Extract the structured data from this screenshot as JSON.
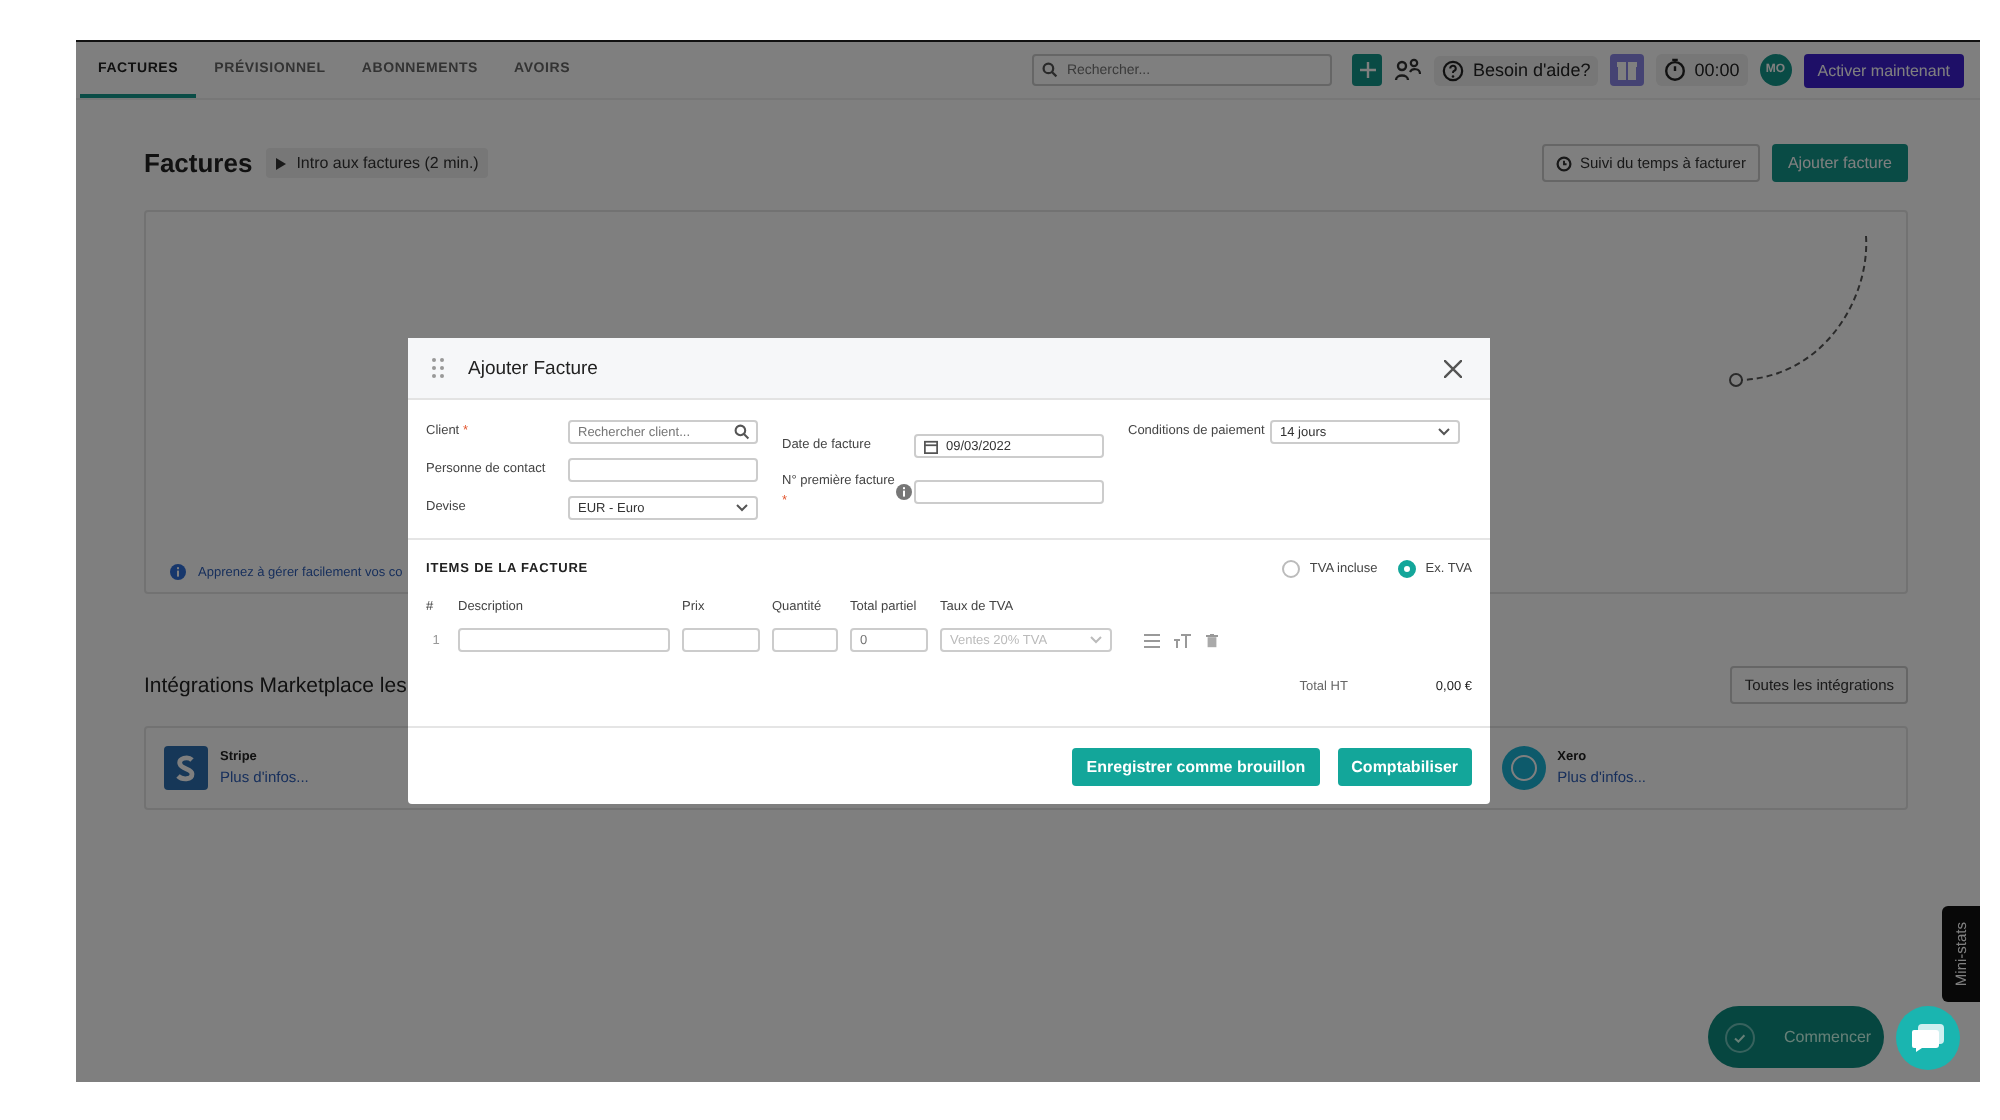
{
  "top_tabs": [
    {
      "label": "FACTURES",
      "selected": true
    },
    {
      "label": "PRÉVISIONNEL",
      "selected": false
    },
    {
      "label": "ABONNEMENTS",
      "selected": false
    },
    {
      "label": "AVOIRS",
      "selected": false
    }
  ],
  "search": {
    "placeholder": "Rechercher..."
  },
  "help": "Besoin d'aide?",
  "timer": "00:00",
  "avatar": "MO",
  "activate_button": "Activer maintenant",
  "page": {
    "title": "Factures",
    "intro": "Intro aux factures (2 min.)",
    "time_button": "Suivi du temps à facturer",
    "add_button": "Ajouter facture"
  },
  "empty_state": {
    "info": "Apprenez à gérer facilement vos co"
  },
  "integrations": {
    "title": "Intégrations Marketplace les",
    "button": "Toutes les intégrations",
    "items": [
      {
        "name": "Stripe",
        "link": "Plus d'infos...",
        "kind": "square"
      },
      {
        "name": "Xero",
        "link": "Plus d'infos...",
        "kind": "round"
      }
    ]
  },
  "modal": {
    "title": "Ajouter Facture",
    "client": {
      "label": "Client",
      "required_mark": "*",
      "placeholder": "Rechercher client..."
    },
    "contact": {
      "label": "Personne de contact"
    },
    "currency": {
      "label": "Devise",
      "value": "EUR - Euro"
    },
    "date": {
      "label": "Date de facture",
      "value": "09/03/2022"
    },
    "number": {
      "label": "N° première facture",
      "required_mark": "*"
    },
    "terms": {
      "label": "Conditions de paiement",
      "value": "14 jours"
    },
    "items_title": "ITEMS DE LA FACTURE",
    "tva_options": [
      {
        "label": "TVA incluse",
        "selected": false
      },
      {
        "label": "Ex. TVA",
        "selected": true
      }
    ],
    "columns": [
      "#",
      "Description",
      "Prix",
      "Quantité",
      "Total partiel",
      "Taux de TVA"
    ],
    "row": {
      "index": "1",
      "subtotal_placeholder": "0",
      "vat": "Ventes 20% TVA"
    },
    "total_label": "Total HT",
    "total_value": "0,00 €",
    "buttons": [
      "Enregistrer comme brouillon",
      "Comptabiliser"
    ]
  },
  "start_button": "Commencer",
  "mini_stats": "Mini-stats"
}
